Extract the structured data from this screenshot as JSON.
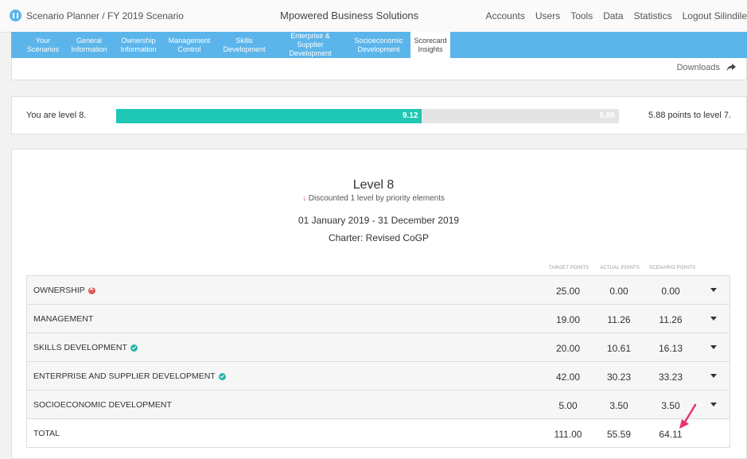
{
  "header": {
    "breadcrumb": "Scenario Planner / FY 2019 Scenario",
    "company": "Mpowered Business Solutions",
    "nav": [
      "Accounts",
      "Users",
      "Tools",
      "Data",
      "Statistics",
      "Logout Silindile"
    ]
  },
  "tabs": [
    {
      "label": "Your\nScenarios"
    },
    {
      "label": "General\nInformation"
    },
    {
      "label": "Ownership\nInformation"
    },
    {
      "label": "Management\nControl"
    },
    {
      "label": "Skills\nDevelopment"
    },
    {
      "label": "Enterprise & Supplier\nDevelopment"
    },
    {
      "label": "Socioeconomic\nDevelopment"
    },
    {
      "label": "Scorecard\nInsights",
      "active": true
    }
  ],
  "toolbar": {
    "downloads_label": "Downloads"
  },
  "progress": {
    "level_text": "You are level 8.",
    "current_value": "9.12",
    "remaining_value": "5.88",
    "fraction": 0.608,
    "to_next": "5.88 points to level 7.",
    "fill_color": "#1ec8b4"
  },
  "scorecard": {
    "level_title": "Level 8",
    "discount_arrow": "↓",
    "discount_text": "Discounted 1 level by priority elements",
    "period": "01 January 2019 - 31 December 2019",
    "charter": "Charter: Revised CoGP",
    "columns": [
      "TARGET POINTS",
      "ACTUAL POINTS",
      "SCENARIO POINTS"
    ],
    "rows": [
      {
        "label": "OWNERSHIP",
        "status": "fail",
        "target": "25.00",
        "actual": "0.00",
        "scenario": "0.00"
      },
      {
        "label": "MANAGEMENT",
        "status": "none",
        "target": "19.00",
        "actual": "11.26",
        "scenario": "11.26"
      },
      {
        "label": "SKILLS DEVELOPMENT",
        "status": "pass",
        "target": "20.00",
        "actual": "10.61",
        "scenario": "16.13"
      },
      {
        "label": "ENTERPRISE AND SUPPLIER DEVELOPMENT",
        "status": "pass",
        "target": "42.00",
        "actual": "30.23",
        "scenario": "33.23"
      },
      {
        "label": "SOCIOECONOMIC DEVELOPMENT",
        "status": "none",
        "target": "5.00",
        "actual": "3.50",
        "scenario": "3.50"
      }
    ],
    "total": {
      "label": "TOTAL",
      "target": "111.00",
      "actual": "55.59",
      "scenario": "64.11"
    }
  },
  "colors": {
    "accent": "#5bb5ea",
    "fail": "#e05a5a",
    "pass": "#26b5a8",
    "pointer": "#e8336f"
  }
}
